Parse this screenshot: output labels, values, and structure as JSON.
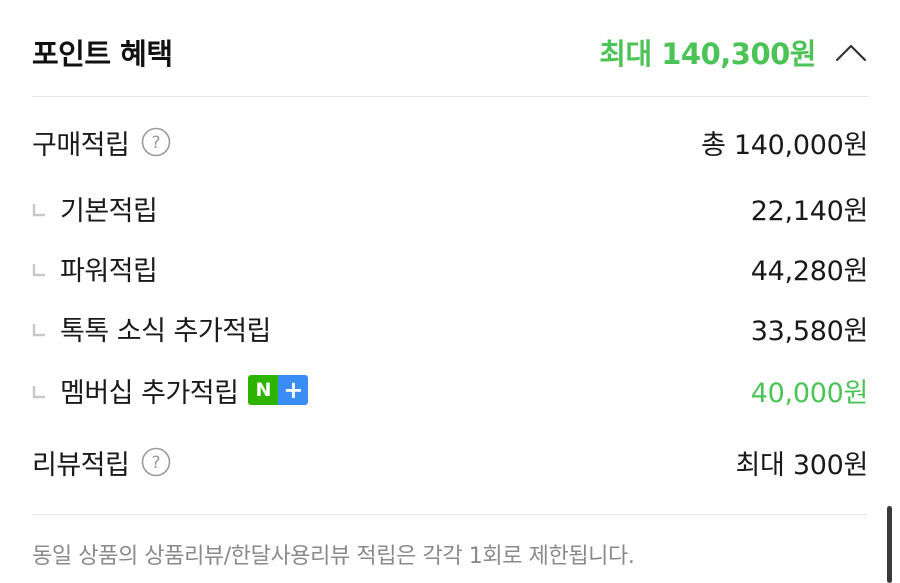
{
  "header": {
    "title": "포인트 혜택",
    "max_amount": "최대 140,300원",
    "toggle_icon": "chevron-up-icon"
  },
  "purchase": {
    "label": "구매적립",
    "value": "총 140,000원",
    "help_icon": "question-circle-icon"
  },
  "sub_items": [
    {
      "label": "기본적립",
      "value": "22,140원"
    },
    {
      "label": "파워적립",
      "value": "44,280원"
    },
    {
      "label": "톡톡 소식 추가적립",
      "value": "33,580원"
    },
    {
      "label": "멤버십 추가적립",
      "value": "40,000원",
      "badge": "N+"
    }
  ],
  "review": {
    "label": "리뷰적립",
    "value": "최대 300원",
    "help_icon": "question-circle-icon"
  },
  "notice": "동일 상품의 상품리뷰/한달사용리뷰 적립은 각각 1회로 제한됩니다.",
  "colors": {
    "accent_green": "#4cc356",
    "naver_green": "#2db400",
    "plus_blue": "#3a8df5",
    "muted_text": "#8a8a8a"
  }
}
